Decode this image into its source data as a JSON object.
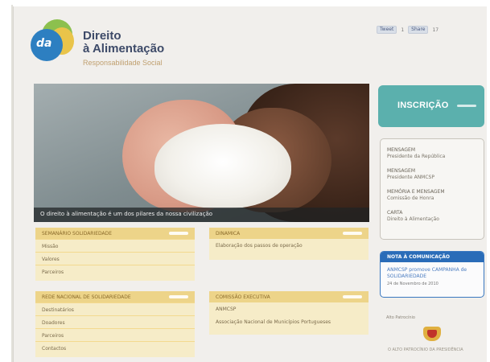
{
  "header": {
    "brand_line1": "Direito",
    "brand_line2": "à Alimentação",
    "brand_tagline": "Responsabilidade Social",
    "logo_text": "da"
  },
  "social": {
    "tweet_label": "Tweet",
    "tweet_count": "1",
    "share_label": "Share",
    "share_count": "17"
  },
  "hero": {
    "caption": "O direito à alimentação é um dos pilares da nossa civilização"
  },
  "inscricao": {
    "label": "INSCRIÇÃO"
  },
  "mensagens": [
    {
      "title": "MENSAGEM",
      "subtitle": "Presidente da República"
    },
    {
      "title": "MENSAGEM",
      "subtitle": "Presidente ANMCSP"
    },
    {
      "title": "MEMÓRIA E MENSAGEM",
      "subtitle": "Comissão de Honra"
    },
    {
      "title": "CARTA",
      "subtitle": "Direito à Alimentação"
    }
  ],
  "nota": {
    "heading": "NOTA À COMUNICAÇÃO",
    "link": "ANMCSP promove CAMPANHA de SOLIDARIEDADE",
    "date": "24 de Novembro de 2010"
  },
  "apoio": {
    "label": "Alto Patrocínio",
    "seal_caption": "O ALTO PATROCÍNIO DA PRESIDÊNCIA"
  },
  "panels": {
    "p1": {
      "title": "SEMANÁRIO SOLIDARIEDADE",
      "items": [
        "Missão",
        "Valores",
        "Parceiros"
      ]
    },
    "p2": {
      "title": "DINAMICA",
      "items": [
        "Elaboração dos passos de operação"
      ]
    },
    "p3": {
      "title": "REDE NACIONAL DE SOLIDARIEDADE",
      "items": [
        "Destinatários",
        "Doadores",
        "Parceiros",
        "Contactos"
      ]
    },
    "p4": {
      "title": "COMISSÃO EXECUTIVA",
      "items": [
        "ANMCSP",
        "Associação Nacional de Municípios Portugueses"
      ]
    }
  },
  "colors": {
    "page_bg": "#f1efec",
    "accent_teal": "#5bb0ad",
    "panel_header": "#edd489",
    "panel_body": "#f6ecc8",
    "nota_blue": "#2a6cb8"
  }
}
